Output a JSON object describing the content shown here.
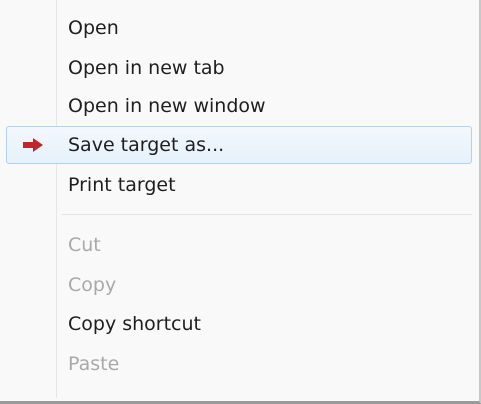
{
  "menu": {
    "items": [
      {
        "label": "Open",
        "enabled": true
      },
      {
        "label": "Open in new tab",
        "enabled": true
      },
      {
        "label": "Open in new window",
        "enabled": true
      },
      {
        "label": "Save target as...",
        "enabled": true,
        "highlighted": true
      },
      {
        "label": "Print target",
        "enabled": true
      },
      {
        "label": "Cut",
        "enabled": false
      },
      {
        "label": "Copy",
        "enabled": false
      },
      {
        "label": "Copy shortcut",
        "enabled": true
      },
      {
        "label": "Paste",
        "enabled": false
      }
    ],
    "pointer_icon": "red-arrow-right-icon",
    "accent_color": "#c0262c",
    "highlight_border": "#b0d2ee"
  }
}
